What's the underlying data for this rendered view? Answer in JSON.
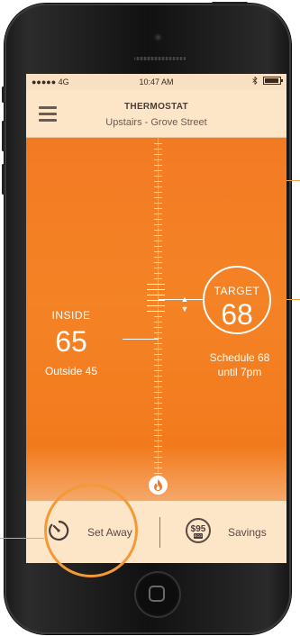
{
  "statusbar": {
    "carrier": "●●●●● 4G",
    "time": "10:47 AM",
    "bluetooth": "bluetooth-icon"
  },
  "header": {
    "title": "THERMOSTAT",
    "subtitle": "Upstairs - Grove Street",
    "menu_icon": "hamburger-menu-icon"
  },
  "inside": {
    "label": "INSIDE",
    "value": "65",
    "outside": "Outside 45"
  },
  "target": {
    "label": "TARGET",
    "value": "68",
    "up_arrow": "▲",
    "down_arrow": "▼",
    "schedule_line1": "Schedule 68",
    "schedule_line2": "until 7pm"
  },
  "footer": {
    "away_label": "Set Away",
    "eco_amount": "$95",
    "eco_tag": "ECO",
    "savings_label": "Savings"
  },
  "colors": {
    "accent": "#f37a24",
    "panel": "#fde5c8",
    "annotation": "#f39a37"
  }
}
